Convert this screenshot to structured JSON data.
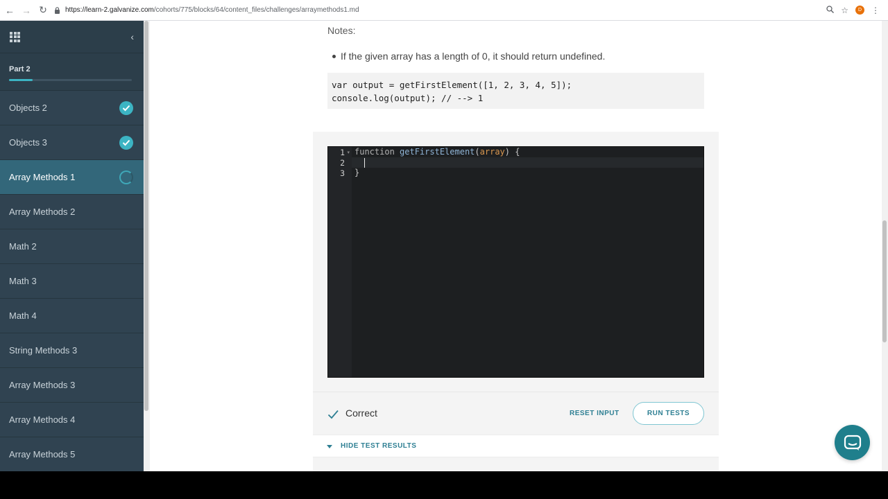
{
  "browser": {
    "url_host": "https://learn-2.galvanize.com",
    "url_path": "/cohorts/775/blocks/64/content_files/challenges/arraymethods1.md",
    "profile_initial": "D"
  },
  "sidebar": {
    "part_label": "Part 2",
    "progress_fraction": 0.19,
    "items": [
      {
        "label": "Objects 2",
        "status": "complete"
      },
      {
        "label": "Objects 3",
        "status": "complete"
      },
      {
        "label": "Array Methods 1",
        "status": "in-progress"
      },
      {
        "label": "Array Methods 2",
        "status": "none"
      },
      {
        "label": "Math 2",
        "status": "none"
      },
      {
        "label": "Math 3",
        "status": "none"
      },
      {
        "label": "Math 4",
        "status": "none"
      },
      {
        "label": "String Methods 3",
        "status": "none"
      },
      {
        "label": "Array Methods 3",
        "status": "none"
      },
      {
        "label": "Array Methods 4",
        "status": "none"
      },
      {
        "label": "Array Methods 5",
        "status": "none"
      }
    ]
  },
  "notes": {
    "title": "Notes:",
    "bullet": "If the given array has a length of 0, it should return undefined.",
    "code_sample": "var output = getFirstElement([1, 2, 3, 4, 5]);\nconsole.log(output); // --> 1"
  },
  "editor": {
    "line_numbers": [
      "1",
      "2",
      "3"
    ],
    "line1_keyword": "function",
    "line1_name": "getFirstElement",
    "line1_open": "(",
    "line1_param": "array",
    "line1_close": ") {",
    "line3": "}"
  },
  "result": {
    "status_label": "Correct",
    "reset_label": "RESET INPUT",
    "run_label": "RUN TESTS",
    "hide_label": "HIDE TEST RESULTS"
  },
  "colors": {
    "accent": "#2e7f93",
    "sidebar_bg": "#2c3e4a",
    "sidebar_active": "#33677a",
    "check": "#3cb4c3"
  }
}
